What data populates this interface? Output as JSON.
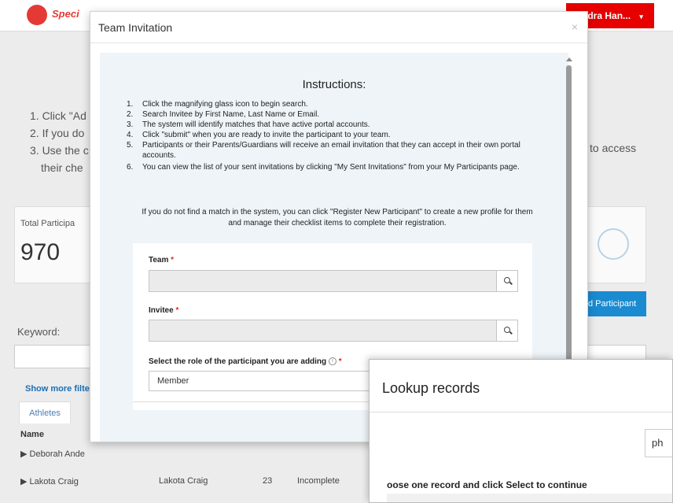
{
  "background": {
    "brand_name": "Speci",
    "user_name": "aedra Han...",
    "user_caret": "▾",
    "steps": [
      "1. Click \"Ad",
      "2. If you do",
      "3. Use the c",
      "their che"
    ],
    "step3_tail": "to access",
    "total_label": "Total Participa",
    "total_value": "970",
    "add_button": "d Participant",
    "keyword_label": "Keyword:",
    "show_more": "Show more filte",
    "tab": "Athletes",
    "table_header_name": "Name",
    "rows": [
      {
        "name": "▶ Deborah Ande",
        "col2": "",
        "col3": "",
        "col4": ""
      },
      {
        "name": "▶ Lakota Craig",
        "col2": "Lakota Craig",
        "col3": "23",
        "col4": "Incomplete"
      }
    ]
  },
  "modal": {
    "title": "Team Invitation",
    "close": "×",
    "instructions_title": "Instructions:",
    "instructions": [
      {
        "num": "1.",
        "text": "Click the magnifying glass icon to begin search."
      },
      {
        "num": "2.",
        "text": "Search Invitee by First Name, Last Name or Email."
      },
      {
        "num": "3.",
        "text": "The system will identify matches that have active portal accounts."
      },
      {
        "num": "4.",
        "text": "Click \"submit\" when you are ready to invite the participant to your team."
      },
      {
        "num": "5.",
        "text": "Participants or their Parents/Guardians will receive an email invitation that they can accept in their own portal accounts."
      },
      {
        "num": "6.",
        "text": "You can view the list of your sent invitations by clicking \"My Sent Invitations\" from your My Participants page."
      }
    ],
    "note": "If you do not find a match in the system, you can click \"Register New Participant\" to create a new profile for them and manage their checklist items to complete their registration.",
    "team_label": "Team",
    "team_value": "",
    "invitee_label": "Invitee",
    "invitee_value": "",
    "required_mark": "*",
    "role_label": "Select the role of the participant you are adding",
    "role_info": "i",
    "role_value": "Member"
  },
  "lookup": {
    "title": "Lookup records",
    "search_value": "ph",
    "hint": "oose one record and click Select to continue"
  }
}
